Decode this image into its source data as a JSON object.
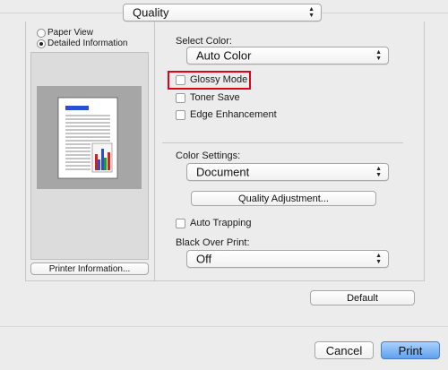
{
  "header": {
    "quality_label": "Quality"
  },
  "view_options": {
    "paper_view": "Paper View",
    "detailed_information": "Detailed Information",
    "selected": "Detailed Information"
  },
  "preview": {
    "printer_info_button": "Printer Information..."
  },
  "select_color": {
    "label": "Select Color:",
    "value": "Auto Color"
  },
  "options": {
    "glossy_mode": "Glossy Mode",
    "toner_save": "Toner Save",
    "edge_enhancement": "Edge Enhancement"
  },
  "color_settings": {
    "label": "Color Settings:",
    "value": "Document",
    "quality_adjustment_button": "Quality Adjustment..."
  },
  "auto_trapping": "Auto Trapping",
  "black_over_print": {
    "label": "Black Over Print:",
    "value": "Off"
  },
  "default_button": "Default",
  "dialog_buttons": {
    "cancel": "Cancel",
    "print": "Print"
  },
  "colors": {
    "highlight": "#e3001b",
    "print_button": "#6aa9f0"
  }
}
